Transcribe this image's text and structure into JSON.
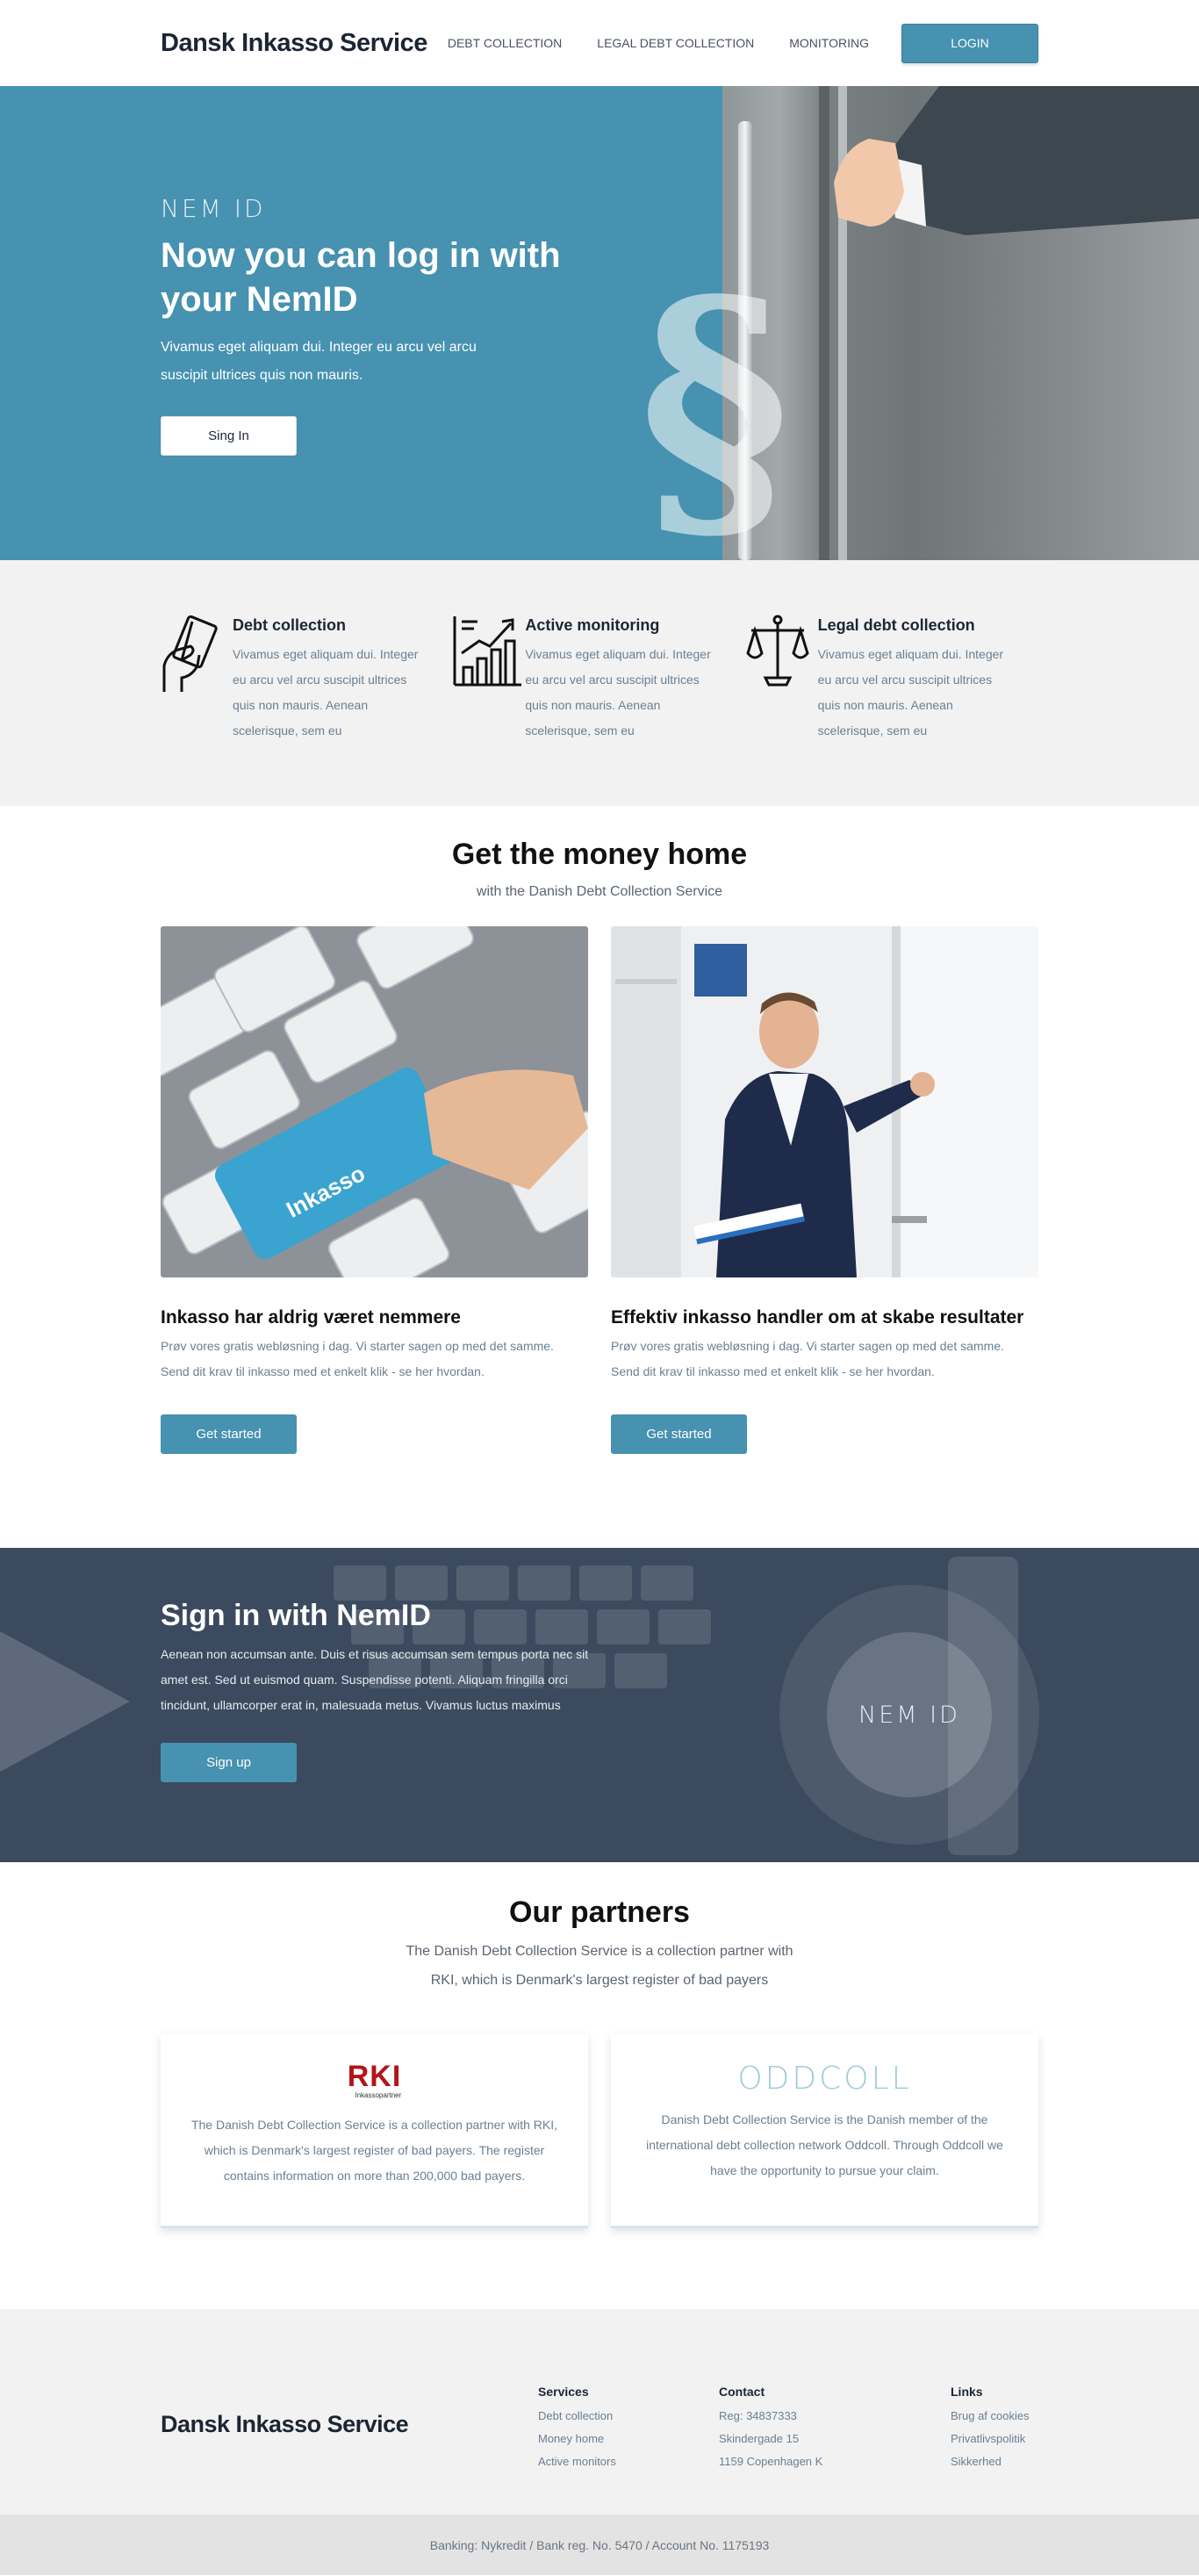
{
  "header": {
    "logo": "Dansk Inkasso Service",
    "nav": [
      "DEBT COLLECTION",
      "LEGAL DEBT COLLECTION",
      "MONITORING"
    ],
    "login_label": "LOGIN"
  },
  "hero": {
    "tag": "NEM ID",
    "title": "Now you can log in with your NemID",
    "text": "Vivamus eget aliquam dui. Integer eu arcu vel arcu suscipit ultrices quis non mauris.",
    "button": "Sing In",
    "symbol": "§"
  },
  "services": [
    {
      "icon": "card-hand-icon",
      "title": "Debt collection",
      "text": "Vivamus eget aliquam dui. Integer eu arcu vel arcu suscipit ultrices quis non mauris. Aenean scelerisque, sem eu"
    },
    {
      "icon": "growth-chart-icon",
      "title": "Active monitoring",
      "text": "Vivamus eget aliquam dui. Integer eu arcu vel arcu suscipit ultrices quis non mauris. Aenean scelerisque, sem eu"
    },
    {
      "icon": "scales-icon",
      "title": "Legal debt collection",
      "text": "Vivamus eget aliquam dui. Integer eu arcu vel arcu suscipit ultrices quis non mauris. Aenean scelerisque, sem eu"
    }
  ],
  "money": {
    "title": "Get the money home",
    "subtitle": "with the Danish Debt Collection Service",
    "cards": [
      {
        "image_label": "Inkasso",
        "title": "Inkasso har aldrig været nemmere",
        "text": "Prøv vores gratis webløsning i dag. Vi starter sagen op med det samme. Send dit krav til inkasso med et enkelt klik - se her hvordan.",
        "button": "Get started"
      },
      {
        "title": "Effektiv inkasso handler om at skabe resultater",
        "text": "Prøv vores gratis webløsning i dag. Vi starter sagen op med det samme. Send dit krav til inkasso med et enkelt klik - se her hvordan.",
        "button": "Get started"
      }
    ]
  },
  "signin": {
    "title": "Sign in with NemID",
    "text": "Aenean non accumsan ante. Duis et risus accumsan sem tempus porta nec sit amet est. Sed ut euismod quam. Suspendisse potenti. Aliquam fringilla orci tincidunt, ullamcorper erat in, malesuada metus. Vivamus luctus maximus",
    "button": "Sign up",
    "badge": "NEM ID"
  },
  "partners": {
    "title": "Our partners",
    "subtitle": "The Danish Debt Collection Service is a collection partner with RKI, which is Denmark's largest register of bad payers",
    "cards": [
      {
        "logo": "RKI",
        "logo_sub": "Inkassopartner",
        "text": "The Danish Debt Collection Service is a collection partner with RKI, which is Denmark's largest register of bad payers. The register contains information on more than 200,000 bad payers."
      },
      {
        "logo": "ODDCOLL",
        "text": "Danish Debt Collection Service is the Danish member of the international debt collection network Oddcoll. Through Oddcoll we have the opportunity to pursue your claim."
      }
    ]
  },
  "footer": {
    "logo": "Dansk Inkasso Service",
    "columns": [
      {
        "title": "Services",
        "links": [
          "Debt collection",
          "Money home",
          "Active monitors"
        ]
      },
      {
        "title": "Contact",
        "links": [
          "Reg: 34837333",
          "Skindergade 15",
          "1159 Copenhagen K"
        ]
      },
      {
        "title": "Links",
        "links": [
          "Brug af cookies",
          "Privatlivspolitik",
          "Sikkerhed"
        ]
      }
    ],
    "bottom": "Banking: Nykredit / Bank reg. No. 5470 / Account No. 1175193"
  },
  "colors": {
    "accent": "#4692b0",
    "dark_banner": "#3b4a5e",
    "light_bg": "#f2f2f2",
    "rki_red": "#b3141c"
  }
}
